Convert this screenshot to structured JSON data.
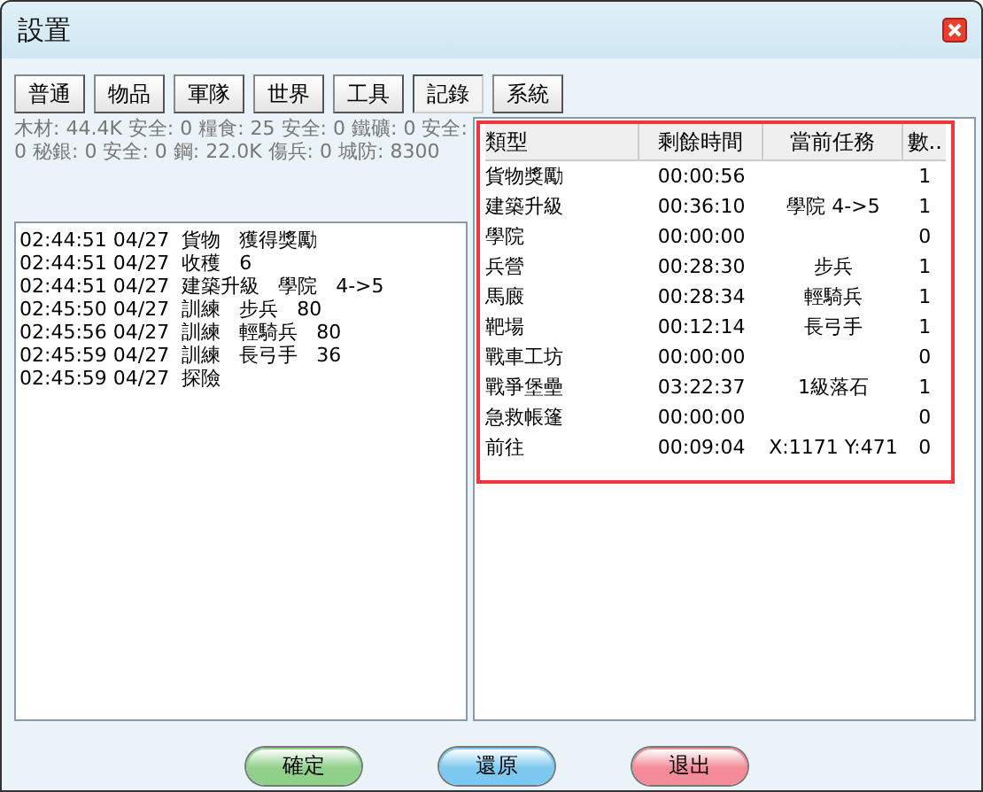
{
  "window": {
    "title": "設置"
  },
  "tabs": [
    {
      "label": "普通",
      "selected": false
    },
    {
      "label": "物品",
      "selected": false
    },
    {
      "label": "軍隊",
      "selected": false
    },
    {
      "label": "世界",
      "selected": false
    },
    {
      "label": "工具",
      "selected": false
    },
    {
      "label": "記錄",
      "selected": true
    },
    {
      "label": "系統",
      "selected": false
    }
  ],
  "resources": "木材: 44.4K 安全: 0   糧食: 25 安全: 0   鐵礦: 0 安全: 0   秘銀: 0 安全: 0   鋼: 22.0K   傷兵: 0   城防: 8300",
  "log": [
    "02:44:51 04/27  貨物   獲得獎勵",
    "02:44:51 04/27  收穫   6",
    "02:44:51 04/27  建築升級   學院   4->5",
    "02:45:50 04/27  訓練   步兵   80",
    "02:45:56 04/27  訓練   輕騎兵   80",
    "02:45:59 04/27  訓練   長弓手   36",
    "02:45:59 04/27  探險"
  ],
  "table": {
    "columns": [
      "類型",
      "剩餘時間",
      "當前任務",
      "數.."
    ],
    "rows": [
      [
        "貨物獎勵",
        "00:00:56",
        "",
        "1"
      ],
      [
        "建築升級",
        "00:36:10",
        "學院 4->5",
        "1"
      ],
      [
        "學院",
        "00:00:00",
        "",
        "0"
      ],
      [
        "兵營",
        "00:28:30",
        "步兵",
        "1"
      ],
      [
        "馬廄",
        "00:28:34",
        "輕騎兵",
        "1"
      ],
      [
        "靶場",
        "00:12:14",
        "長弓手",
        "1"
      ],
      [
        "戰車工坊",
        "00:00:00",
        "",
        "0"
      ],
      [
        "戰爭堡壘",
        "03:22:37",
        "1級落石",
        "1"
      ],
      [
        "急救帳篷",
        "00:00:00",
        "",
        "0"
      ],
      [
        "前往",
        "00:09:04",
        "X:1171 Y:471",
        "0"
      ]
    ],
    "highlighted": true
  },
  "buttons": [
    {
      "label": "確定",
      "color": "#8fd18a"
    },
    {
      "label": "還原",
      "color": "#7cc8f0"
    },
    {
      "label": "退出",
      "color": "#f58a98"
    }
  ]
}
